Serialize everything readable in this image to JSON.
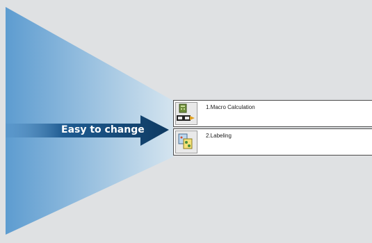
{
  "arrow": {
    "label": "Easy to change"
  },
  "items": [
    {
      "label": "1.Macro Calculation",
      "icon": "macro-calculation-icon"
    },
    {
      "label": "2.Labeling",
      "icon": "labeling-icon"
    }
  ],
  "colors": {
    "background": "#dfe1e3",
    "beam_start": "#5d9cd0",
    "beam_end": "#cfe1ee",
    "arrow_dark": "#0e3a62",
    "arrow_light": "#3a7ab2"
  }
}
